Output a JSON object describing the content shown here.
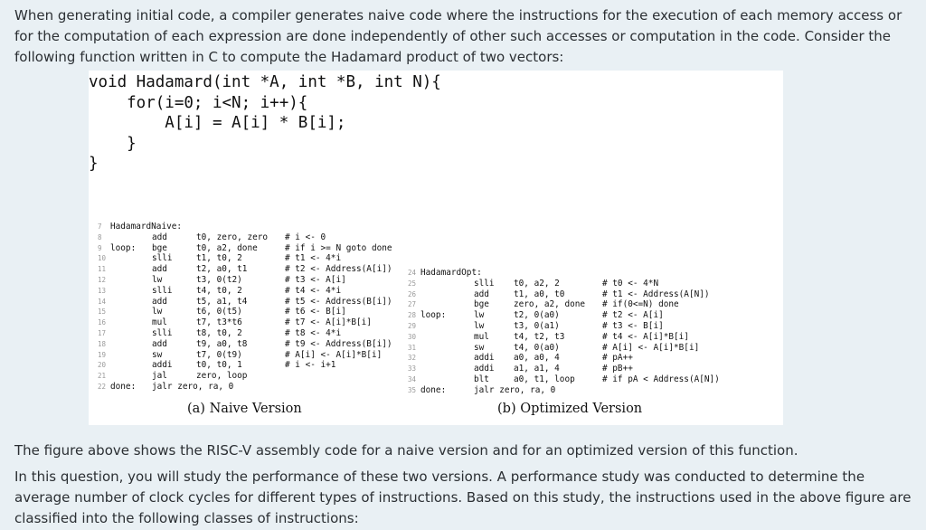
{
  "intro": "When generating initial code, a compiler generates naive code where the instructions for the execution of each memory access or for the computation of each expression are done independently of other such accesses or computation in the code. Consider the following function written in C to compute the Hadamard product of two vectors:",
  "c_code": [
    "void Hadamard(int *A, int *B, int N){",
    "    for(i=0; i<N; i++){",
    "        A[i] = A[i] * B[i];",
    "    }",
    "}"
  ],
  "naive": {
    "caption": "(a) Naive Version",
    "lines": [
      {
        "n": "7",
        "label": "HadamardNaive:",
        "op": "",
        "args": "",
        "comment": ""
      },
      {
        "n": "8",
        "label": "",
        "op": "add",
        "args": "t0, zero, zero",
        "comment": "# i <- 0"
      },
      {
        "n": "9",
        "label": "loop:",
        "op": "bge",
        "args": "t0, a2, done",
        "comment": "# if i >= N goto done"
      },
      {
        "n": "10",
        "label": "",
        "op": "slli",
        "args": "t1, t0, 2",
        "comment": "# t1 <- 4*i"
      },
      {
        "n": "11",
        "label": "",
        "op": "add",
        "args": "t2, a0, t1",
        "comment": "# t2 <- Address(A[i])"
      },
      {
        "n": "12",
        "label": "",
        "op": "lw",
        "args": "t3, 0(t2)",
        "comment": "# t3 <- A[i]"
      },
      {
        "n": "13",
        "label": "",
        "op": "slli",
        "args": "t4, t0, 2",
        "comment": "# t4 <- 4*i"
      },
      {
        "n": "14",
        "label": "",
        "op": "add",
        "args": "t5, a1, t4",
        "comment": "# t5 <- Address(B[i])"
      },
      {
        "n": "15",
        "label": "",
        "op": "lw",
        "args": "t6, 0(t5)",
        "comment": "# t6 <- B[i]"
      },
      {
        "n": "16",
        "label": "",
        "op": "mul",
        "args": "t7, t3*t6",
        "comment": "# t7 <- A[i]*B[i]"
      },
      {
        "n": "17",
        "label": "",
        "op": "slli",
        "args": "t8, t0, 2",
        "comment": "# t8 <- 4*i"
      },
      {
        "n": "18",
        "label": "",
        "op": "add",
        "args": "t9, a0, t8",
        "comment": "# t9 <- Address(B[i])"
      },
      {
        "n": "19",
        "label": "",
        "op": "sw",
        "args": "t7, 0(t9)",
        "comment": "# A[i] <- A[i]*B[i]"
      },
      {
        "n": "20",
        "label": "",
        "op": "addi",
        "args": "t0, t0, 1",
        "comment": "# i <- i+1"
      },
      {
        "n": "21",
        "label": "",
        "op": "jal",
        "args": "zero, loop",
        "comment": ""
      },
      {
        "n": "22",
        "label": "done:",
        "op": "jalr zero, ra, 0",
        "args": "",
        "comment": ""
      }
    ]
  },
  "optimized": {
    "caption": "(b) Optimized Version",
    "lines": [
      {
        "n": "24",
        "label": "HadamardOpt:",
        "op": "",
        "args": "",
        "comment": ""
      },
      {
        "n": "25",
        "label": "",
        "op": "slli",
        "args": "t0, a2, 2",
        "comment": "# t0 <- 4*N"
      },
      {
        "n": "26",
        "label": "",
        "op": "add",
        "args": "t1, a0, t0",
        "comment": "# t1 <- Address(A[N])"
      },
      {
        "n": "27",
        "label": "",
        "op": "bge",
        "args": "zero, a2, done",
        "comment": "# if(0<=N) done"
      },
      {
        "n": "28",
        "label": "loop:",
        "op": "lw",
        "args": "t2, 0(a0)",
        "comment": "# t2 <- A[i]"
      },
      {
        "n": "29",
        "label": "",
        "op": "lw",
        "args": "t3, 0(a1)",
        "comment": "# t3 <- B[i]"
      },
      {
        "n": "30",
        "label": "",
        "op": "mul",
        "args": "t4, t2, t3",
        "comment": "# t4 <- A[i]*B[i]"
      },
      {
        "n": "31",
        "label": "",
        "op": "sw",
        "args": "t4, 0(a0)",
        "comment": "# A[i] <- A[i]*B[i]"
      },
      {
        "n": "32",
        "label": "",
        "op": "addi",
        "args": "a0, a0, 4",
        "comment": "# pA++"
      },
      {
        "n": "33",
        "label": "",
        "op": "addi",
        "args": "a1, a1, 4",
        "comment": "# pB++"
      },
      {
        "n": "34",
        "label": "",
        "op": "blt",
        "args": "a0, t1, loop",
        "comment": "# if pA < Address(A[N])"
      },
      {
        "n": "35",
        "label": "done:",
        "op": "jalr zero, ra, 0",
        "args": "",
        "comment": ""
      }
    ]
  },
  "para2": "The figure above shows the RISC-V assembly code for a naive version and for an optimized version of this function.",
  "para3": "In this question, you will study the performance of these two versions. A performance study was conducted to determine the average number of clock cycles for different types of instructions. Based on this study, the instructions used in the above figure are classified into the following classes of instructions:"
}
